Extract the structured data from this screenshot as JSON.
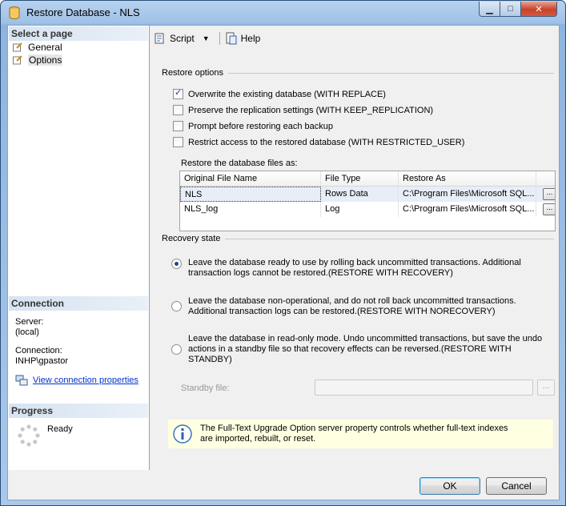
{
  "window": {
    "title": "Restore Database - NLS"
  },
  "sidebar": {
    "select_page_title": "Select a page",
    "pages": [
      {
        "label": "General"
      },
      {
        "label": "Options"
      }
    ],
    "connection_title": "Connection",
    "server_label": "Server:",
    "server_value": "(local)",
    "connection_label": "Connection:",
    "connection_value": "INHP\\gpastor",
    "view_props_link": "View connection properties",
    "progress_title": "Progress",
    "progress_status": "Ready"
  },
  "toolbar": {
    "script_label": "Script",
    "help_label": "Help"
  },
  "restore_options": {
    "title": "Restore options",
    "options": [
      {
        "label": "Overwrite the existing database (WITH REPLACE)",
        "checked": true
      },
      {
        "label": "Preserve the replication settings (WITH KEEP_REPLICATION)",
        "checked": false
      },
      {
        "label": "Prompt before restoring each backup",
        "checked": false
      },
      {
        "label": "Restrict access to the restored database (WITH RESTRICTED_USER)",
        "checked": false
      }
    ],
    "files_label": "Restore the database files as:",
    "columns": [
      "Original File Name",
      "File Type",
      "Restore As"
    ],
    "rows": [
      {
        "name": "NLS",
        "type": "Rows Data",
        "restore_as": "C:\\Program Files\\Microsoft SQL..."
      },
      {
        "name": "NLS_log",
        "type": "Log",
        "restore_as": "C:\\Program Files\\Microsoft SQL..."
      }
    ],
    "browse_label": "..."
  },
  "recovery": {
    "title": "Recovery state",
    "options": [
      {
        "label": "Leave the database ready to use by rolling back uncommitted transactions. Additional transaction logs cannot be restored.(RESTORE WITH RECOVERY)",
        "selected": true
      },
      {
        "label": "Leave the database non-operational, and do not roll back uncommitted transactions. Additional transaction logs can be restored.(RESTORE WITH NORECOVERY)",
        "selected": false
      },
      {
        "label": "Leave the database in read-only mode. Undo uncommitted transactions, but save the undo actions in a standby file so that recovery effects can be reversed.(RESTORE WITH STANDBY)",
        "selected": false
      }
    ],
    "standby_label": "Standby file:",
    "standby_value": "",
    "browse_label": "..."
  },
  "info": {
    "text": "The Full-Text Upgrade Option server property controls whether full-text indexes are imported, rebuilt, or reset."
  },
  "footer": {
    "ok_label": "OK",
    "cancel_label": "Cancel"
  },
  "colors": {
    "accent": "#2b4f7a",
    "link": "#0033cc",
    "info_bg": "#ffffe1",
    "close_button": "#c7432a"
  },
  "icons": {
    "title": "database-icon",
    "page": "page-icon",
    "script": "script-icon",
    "help": "help-icon",
    "info": "info-icon",
    "connection": "connection-properties-icon",
    "progress": "spinner-icon"
  }
}
